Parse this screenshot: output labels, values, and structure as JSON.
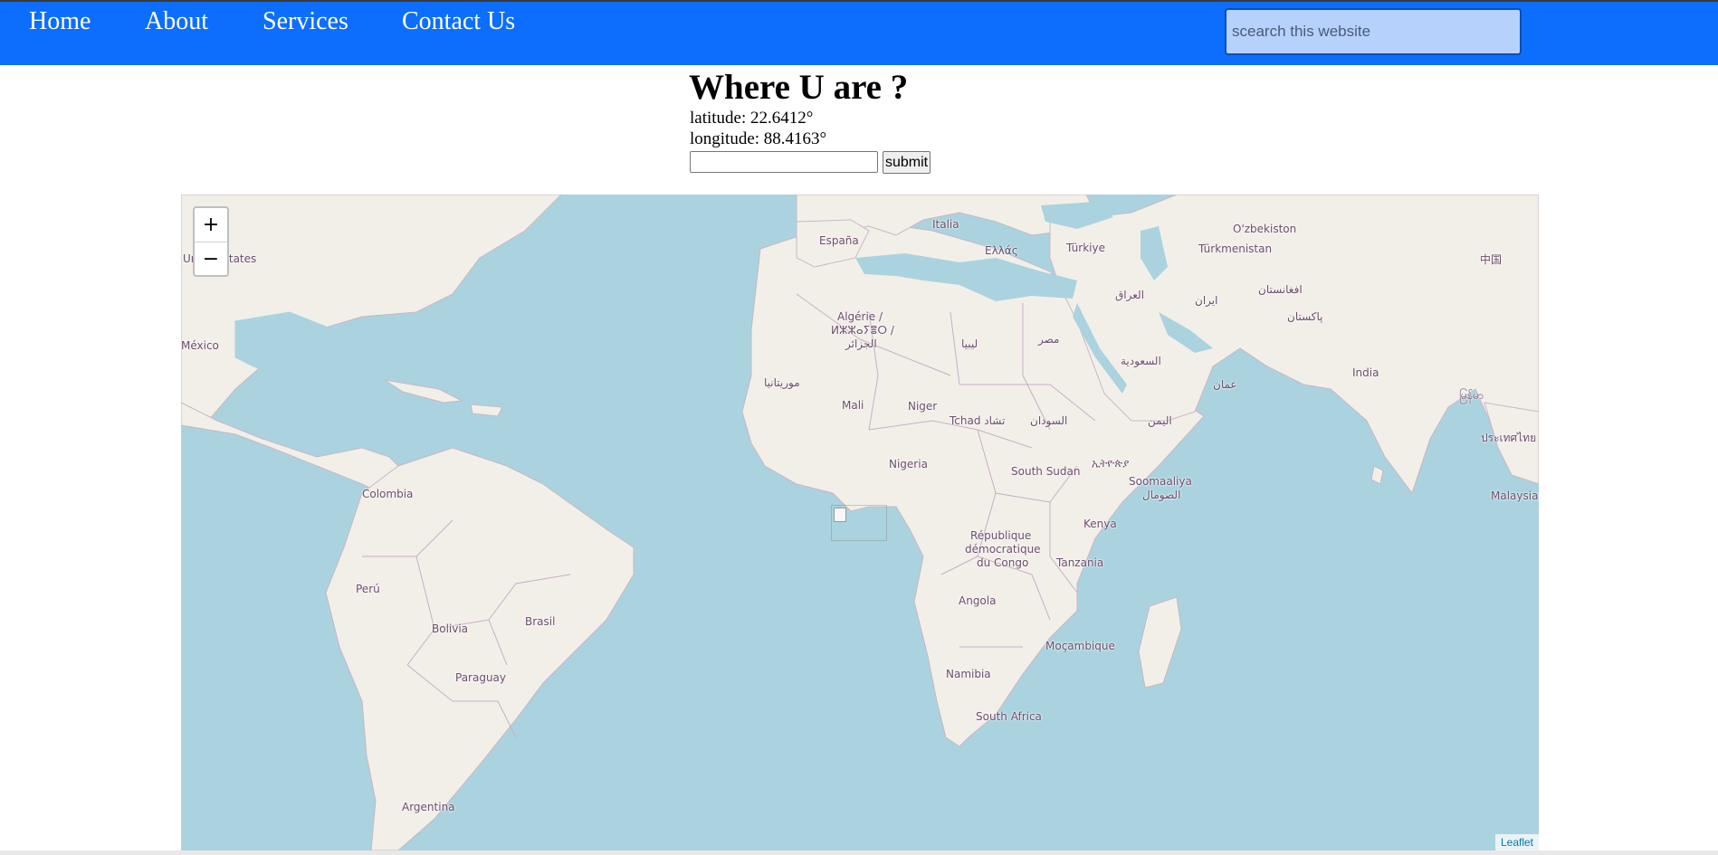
{
  "nav": {
    "links": [
      "Home",
      "About",
      "Services",
      "Contact Us"
    ],
    "search_placeholder": "scearch this website"
  },
  "location": {
    "heading": "Where U are ?",
    "latitude": "latitude: 22.6412°",
    "longitude": "longitude: 88.4163°",
    "submit_label": "submit"
  },
  "map": {
    "zoom_in": "+",
    "zoom_out": "−",
    "attribution": "Leaflet",
    "labels": {
      "united_states": "United States",
      "mexico": "México",
      "colombia": "Colombia",
      "peru": "Perú",
      "bolivia": "Bolivia",
      "brasil": "Brasil",
      "paraguay": "Paraguay",
      "argentina": "Argentina",
      "espana": "España",
      "italia": "Italia",
      "ellas": "Ελλάς",
      "turkiye": "Türkiye",
      "uzbekiston": "O'zbekiston",
      "turkmenistan": "Türkmenistan",
      "china": "中国",
      "algerie_1": "Algérie /",
      "algerie_2": "ⵍⵣⵣⴰⵢⴻⵔ /",
      "algerie_3": "الجزائر",
      "libya": "ليبيا",
      "egypt": "مصر",
      "iraq": "العراق",
      "iran": "ایران",
      "afghanistan": "افغانستان",
      "pakistan": "پاکستان",
      "saudi": "السعودية",
      "oman": "عمان",
      "india": "India",
      "myanmar": "မြန်မာ",
      "thailand": "ประเทศไทย",
      "mauritania": "موريتانيا",
      "mali": "Mali",
      "niger": "Niger",
      "tchad": "Tchad تشاد",
      "sudan": "السودان",
      "yemen": "اليمن",
      "ethiopia": "ኢትዮጵያ",
      "nigeria": "Nigeria",
      "south_sudan": "South Sudan",
      "somalia_1": "Soomaaliya",
      "somalia_2": "الصومال",
      "kenya": "Kenya",
      "drc_1": "République",
      "drc_2": "démocratique",
      "drc_3": "du Congo",
      "tanzania": "Tanzania",
      "angola": "Angola",
      "mocambique": "Moçambique",
      "namibia": "Namibia",
      "south_africa": "South Africa",
      "malaysia": "Malaysia"
    }
  },
  "colors": {
    "navbar": "#0d6efd",
    "ocean": "#aad3df",
    "land": "#f2efe9"
  }
}
